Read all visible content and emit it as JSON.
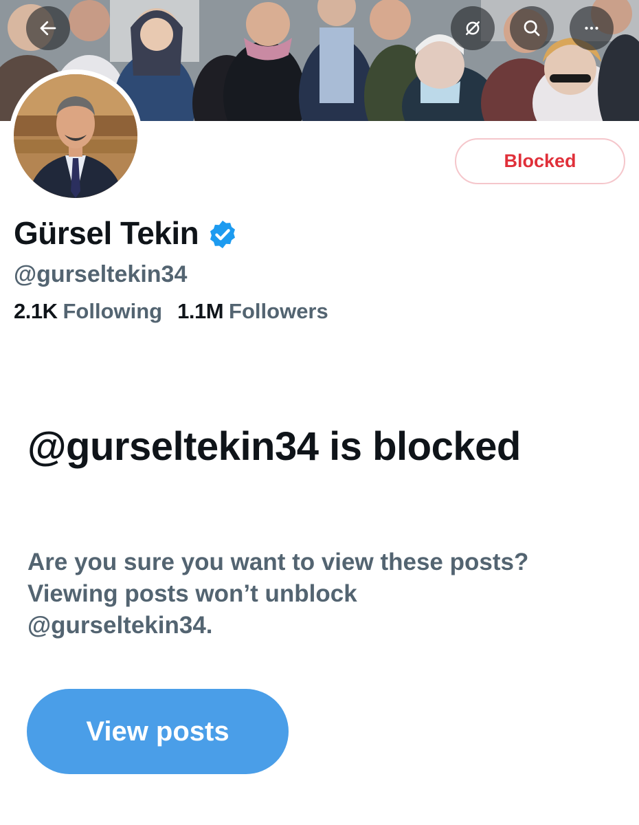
{
  "header": {
    "nav_icons": [
      "back-arrow-icon",
      "grok-icon",
      "search-icon",
      "more-icon"
    ]
  },
  "profile": {
    "display_name": "Gürsel Tekin",
    "verified": true,
    "handle": "@gurseltekin34",
    "following_count": "2.1K",
    "following_label": "Following",
    "followers_count": "1.1M",
    "followers_label": "Followers",
    "blocked_button_label": "Blocked"
  },
  "blocked_notice": {
    "title": "@gurseltekin34 is blocked",
    "description_line1": "Are you sure you want to view these posts?",
    "description_line2": "Viewing posts won’t unblock",
    "description_line3": "@gurseltekin34.",
    "view_posts_label": "View posts"
  },
  "colors": {
    "blocked_red": "#e0303a",
    "blocked_border": "#f5c6cb",
    "primary_blue": "#4a9ee8",
    "text_primary": "#0f1419",
    "text_secondary": "#536471",
    "verified_blue": "#1d9bf0"
  }
}
